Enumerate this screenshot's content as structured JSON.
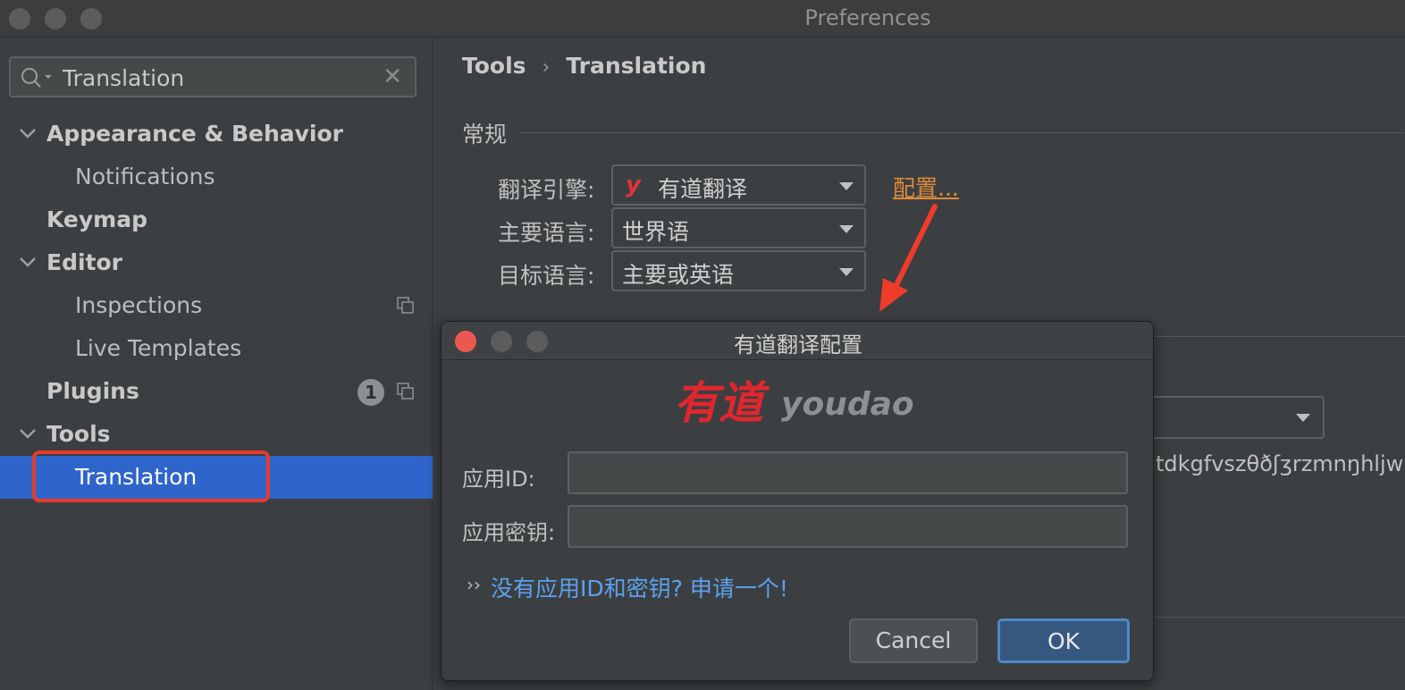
{
  "window": {
    "title": "Preferences"
  },
  "search": {
    "value": "Translation"
  },
  "sidebar": {
    "items": [
      {
        "label": "Appearance & Behavior"
      },
      {
        "label": "Notifications"
      },
      {
        "label": "Keymap"
      },
      {
        "label": "Editor"
      },
      {
        "label": "Inspections"
      },
      {
        "label": "Live Templates"
      },
      {
        "label": "Plugins",
        "badge": "1"
      },
      {
        "label": "Tools"
      },
      {
        "label": "Translation"
      }
    ]
  },
  "main": {
    "breadcrumb": {
      "parent": "Tools",
      "separator": "›",
      "current": "Translation"
    },
    "section": "常规",
    "fields": [
      {
        "label": "翻译引擎:",
        "value": "有道翻译",
        "icon": "y"
      },
      {
        "label": "主要语言:",
        "value": "世界语"
      },
      {
        "label": "目标语言:",
        "value": "主要或英语"
      }
    ],
    "config_link": "配置...",
    "ipa_preview": "tdkgfvszθðʃʒrzmnŋhljw"
  },
  "dialog": {
    "title": "有道翻译配置",
    "logo": {
      "cn": "有道",
      "en": "youdao"
    },
    "app_id_label": "应用ID:",
    "app_key_label": "应用密钥:",
    "link_text": "没有应用ID和密钥? 申请一个!",
    "cancel_label": "Cancel",
    "ok_label": "OK"
  },
  "colors": {
    "accent_selected": "#2f65ca",
    "highlight_red": "#e63b2e",
    "link_orange": "#e0893a",
    "link_blue": "#5aa2f0",
    "close_red": "#e9594f"
  }
}
